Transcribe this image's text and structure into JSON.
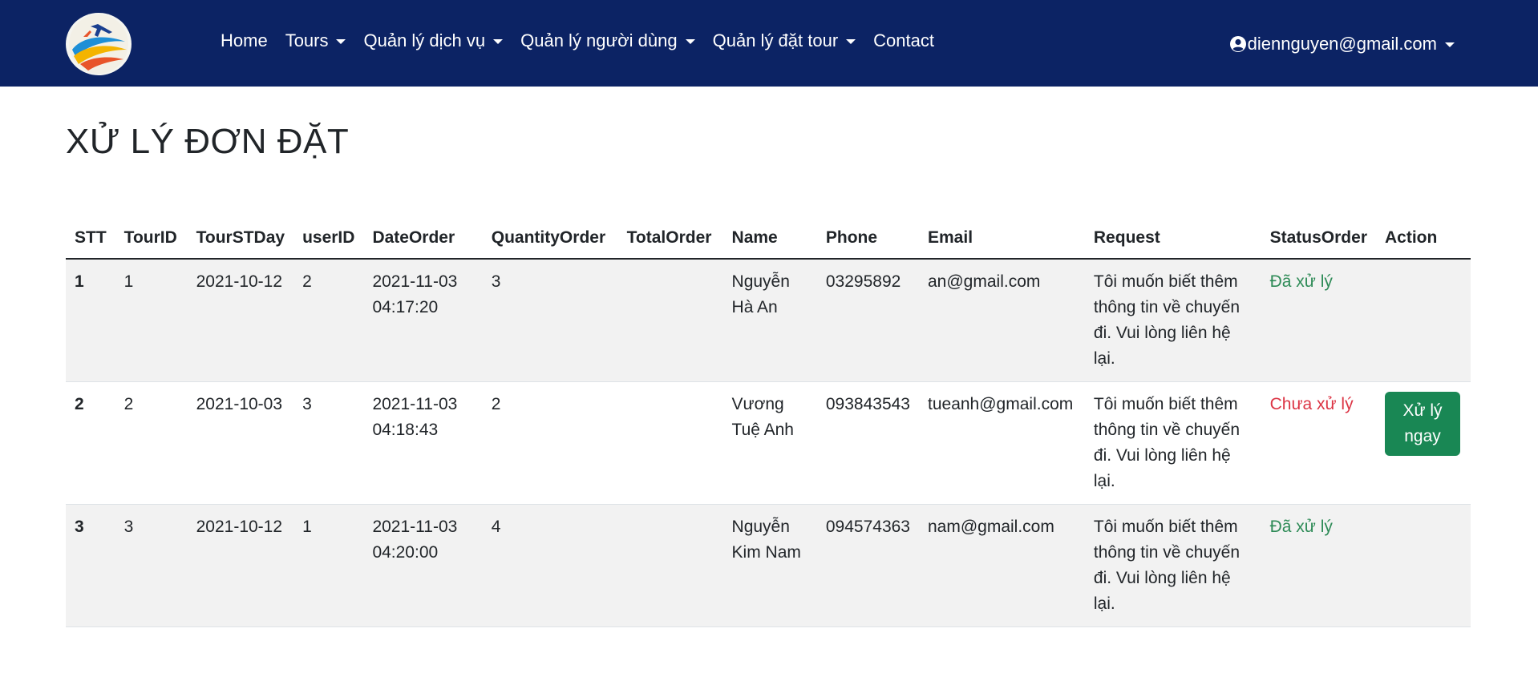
{
  "navbar": {
    "links": [
      {
        "label": "Home",
        "dropdown": false
      },
      {
        "label": "Tours",
        "dropdown": true
      },
      {
        "label": "Quản lý dịch vụ",
        "dropdown": true
      },
      {
        "label": "Quản lý người dùng",
        "dropdown": true
      },
      {
        "label": "Quản lý đặt tour",
        "dropdown": true
      },
      {
        "label": "Contact",
        "dropdown": false
      }
    ],
    "user_email": "diennguyen@gmail.com"
  },
  "page": {
    "title": "XỬ LÝ ĐƠN ĐẶT"
  },
  "table": {
    "headers": [
      "STT",
      "TourID",
      "TourSTDay",
      "userID",
      "DateOrder",
      "QuantityOrder",
      "TotalOrder",
      "Name",
      "Phone",
      "Email",
      "Request",
      "StatusOrder",
      "Action"
    ],
    "rows": [
      {
        "stt": "1",
        "tour_id": "1",
        "tour_st_day": "2021-10-12",
        "user_id": "2",
        "date_order": "2021-11-03 04:17:20",
        "quantity_order": "3",
        "total_order": "",
        "name": "Nguyễn Hà An",
        "phone": "03295892",
        "email": "an@gmail.com",
        "request": "Tôi muốn biết thêm thông tin về chuyến đi. Vui lòng liên hệ lại.",
        "status": "Đã xử lý",
        "action": ""
      },
      {
        "stt": "2",
        "tour_id": "2",
        "tour_st_day": "2021-10-03",
        "user_id": "3",
        "date_order": "2021-11-03 04:18:43",
        "quantity_order": "2",
        "total_order": "",
        "name": "Vương Tuệ Anh",
        "phone": "093843543",
        "email": "tueanh@gmail.com",
        "request": "Tôi muốn biết thêm thông tin về chuyến đi. Vui lòng liên hệ lại.",
        "status": "Chưa xử lý",
        "action": "Xử lý ngay"
      },
      {
        "stt": "3",
        "tour_id": "3",
        "tour_st_day": "2021-10-12",
        "user_id": "1",
        "date_order": "2021-11-03 04:20:00",
        "quantity_order": "4",
        "total_order": "",
        "name": "Nguyễn Kim Nam",
        "phone": "094574363",
        "email": "nam@gmail.com",
        "request": "Tôi muốn biết thêm thông tin về chuyến đi. Vui lòng liên hệ lại.",
        "status": "Đã xử lý",
        "action": ""
      }
    ]
  },
  "icons": {
    "logo": "travel-globe-logo",
    "user": "user-circle-icon",
    "caret": "caret-down-icon"
  },
  "colors": {
    "navbar_bg": "#0c2364",
    "status_done": "#2e8b57",
    "status_pending": "#dc3545",
    "action_button": "#198754",
    "row_stripe": "#f2f2f2"
  }
}
